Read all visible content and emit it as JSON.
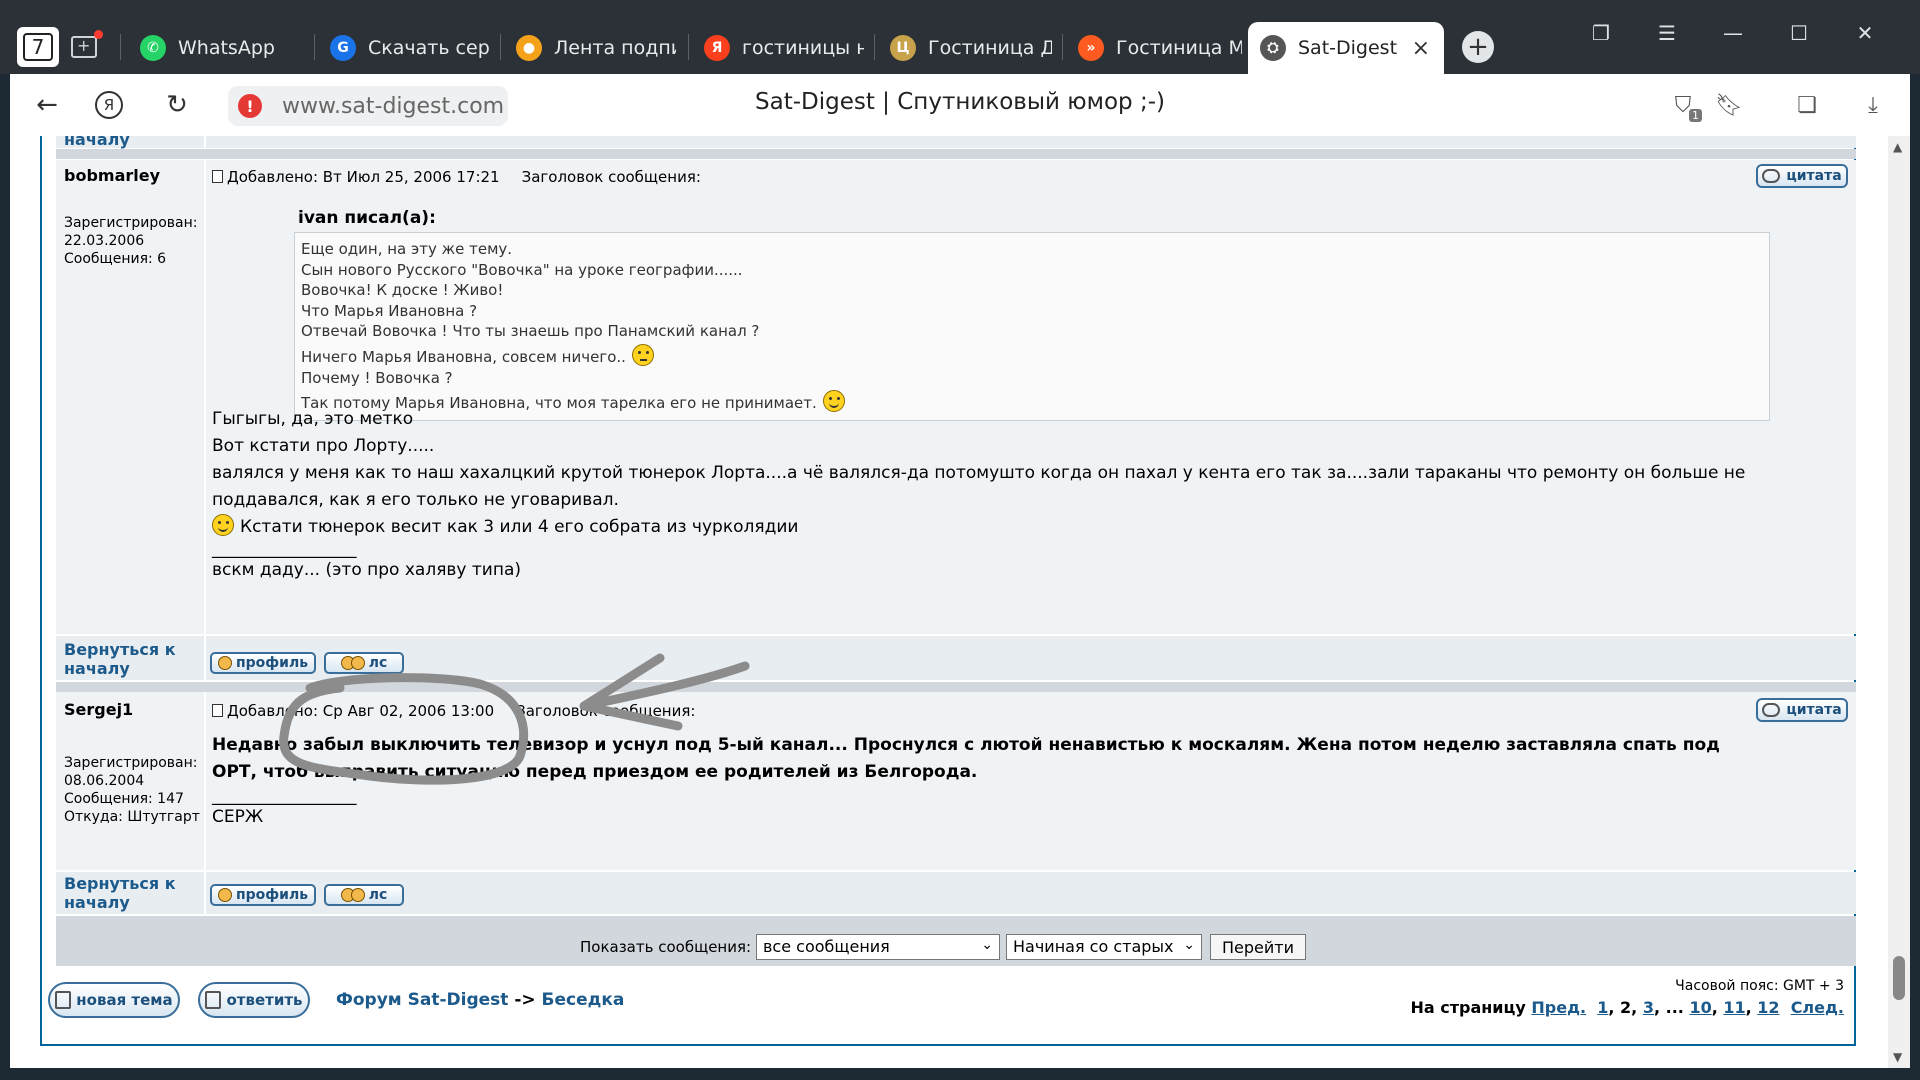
{
  "browser": {
    "tab_counter": "7",
    "tabs": [
      {
        "label": "WhatsApp",
        "icon_color": "#25d366",
        "icon_glyph": "✆"
      },
      {
        "label": "Скачать сери",
        "icon_color": "#1a73e8",
        "icon_glyph": "G"
      },
      {
        "label": "Лента подпис",
        "icon_color": "#f4a21a",
        "icon_glyph": "●"
      },
      {
        "label": "гостиницы н",
        "icon_color": "#fc3f1d",
        "icon_glyph": "Я"
      },
      {
        "label": "Гостиница Д",
        "icon_color": "#c8a24a",
        "icon_glyph": "Ц"
      },
      {
        "label": "Гостиница М",
        "icon_color": "#ff5a1f",
        "icon_glyph": "»"
      },
      {
        "label": "Sat-Digest",
        "icon_color": "#555555",
        "icon_glyph": "⛭"
      }
    ],
    "active_tab_close": "×",
    "new_tab": "+",
    "url": "www.sat-digest.com",
    "page_title": "Sat-Digest | Спутниковый юмор ;-)",
    "shield_badge": "1",
    "yandex_glyph": "Я"
  },
  "prev_post": {
    "back_link_tail": "началу"
  },
  "posts": [
    {
      "username": "bobmarley",
      "reg_label": "Зарегистрирован:",
      "reg_date": "22.03.2006",
      "msgs": "Сообщения: 6",
      "from": "",
      "added": "Добавлено: Вт Июл 25, 2006 17:21",
      "subject_label": "Заголовок сообщения:",
      "quote_label": "цитата",
      "quote_author": "ivan писал(а):",
      "quote_lines": [
        "Еще один, на эту же тему.",
        "Сын нового Русского \"Вовочка\" на уроке географии......",
        "Вовочка! К доске ! Живо!",
        "Что Марья Ивановна ?",
        "Отвечай Вовочка ! Что ты знаешь про Панамский канал ?",
        "Ничего Марья Ивановна, совсем ничего..",
        "Почему ! Вовочка ?",
        "Так потому Марья Ивановна, что моя тарелка его не принимает."
      ],
      "body_lines": [
        "Гыгыгы, да, это метко",
        "Вот кстати про Лорту.....",
        "валялся у меня как то наш хахалцкий крутой тюнерок Лорта....а чё валялся-да потомушто когда он пахал у кента его так за....зали тараканы что ремонту он больше не",
        "поддавался, как я его только не уговаривал.",
        "Кстати тюнерок весит как 3 или 4 его собрата из чурколядии",
        "_________________",
        "вскм даду... (это про халяву типа)"
      ],
      "back_link": "Вернуться к началу",
      "profile_btn": "профиль",
      "pm_btn": "лс"
    },
    {
      "username": "Sergej1",
      "reg_label": "Зарегистрирован:",
      "reg_date": "08.06.2004",
      "msgs": "Сообщения: 147",
      "from": "Откуда: Штутгарт",
      "added": "Добавлено: Ср Авг 02, 2006 13:00",
      "subject_label": "Заголовок сообщения:",
      "quote_label": "цитата",
      "body_lines": [
        "Недавно забыл выключить телевизор и уснул под 5-ый канал... Проснулся с лютой ненавистью к москалям. Жена потом неделю заставляла спать под",
        "ОРТ, чтоб выправить ситуацию перед приездом ее родителей из Белгорода.",
        "_________________",
        "СЕРЖ"
      ],
      "back_link": "Вернуться к началу",
      "profile_btn": "профиль",
      "pm_btn": "лс"
    }
  ],
  "controls": {
    "show_label": "Показать сообщения:",
    "filter_value": "все сообщения",
    "order_value": "Начиная со старых",
    "go_label": "Перейти"
  },
  "footer": {
    "new_topic": "новая тема",
    "reply": "ответить",
    "crumb_forum": "Форум Sat-Digest",
    "crumb_arrow": "->",
    "crumb_section": "Беседка",
    "timezone": "Часовой пояс: GMT + 3",
    "pages_label": "На страницу",
    "prev": "Пред.",
    "p1": "1",
    "p2": "2",
    "p3": "3",
    "ellipsis": "...",
    "p10": "10",
    "p11": "11",
    "p12": "12",
    "next": "След."
  },
  "colors": {
    "link": "#1c5a8c",
    "row_bg": "#eff3f6",
    "separator": "#d1d7dc",
    "annotation": "#8c8c8c"
  }
}
